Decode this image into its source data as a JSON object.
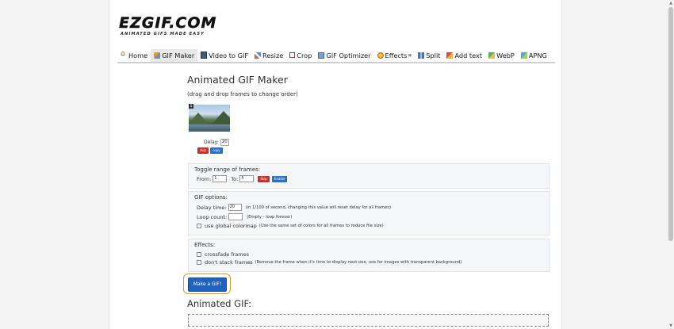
{
  "logo": {
    "main": "EZGIF.COM",
    "tagline": "ANIMATED GIFS MADE EASY"
  },
  "nav": [
    {
      "label": "Home",
      "icon": "home-icon"
    },
    {
      "label": "GIF Maker",
      "icon": "brush-icon",
      "active": true
    },
    {
      "label": "Video to GIF",
      "icon": "film-icon"
    },
    {
      "label": "Resize",
      "icon": "resize-icon"
    },
    {
      "label": "Crop",
      "icon": "crop-icon"
    },
    {
      "label": "GIF Optimizer",
      "icon": "optimizer-icon"
    },
    {
      "label": "Effects",
      "icon": "effects-icon",
      "suffix": "»"
    },
    {
      "label": "Split",
      "icon": "split-icon"
    },
    {
      "label": "Add text",
      "icon": "text-icon"
    },
    {
      "label": "WebP",
      "icon": "webp-icon"
    },
    {
      "label": "APNG",
      "icon": "apng-icon"
    }
  ],
  "main": {
    "title": "Animated GIF Maker",
    "subtitle": "(drag and drop frames to change order)"
  },
  "frame": {
    "number": "1",
    "delay_label": "Delay:",
    "delay_value": "20",
    "skip_label": "skip",
    "copy_label": "copy"
  },
  "toggle": {
    "title": "Toggle range of frames:",
    "from_label": "From:",
    "from_value": "1",
    "to_label": "To:",
    "to_value": "5",
    "skip_label": "Skip",
    "enable_label": "Enable"
  },
  "gif_options": {
    "title": "GIF options:",
    "delay_label": "Delay time:",
    "delay_value": "20",
    "delay_hint": "(in 1/100 of second, changing this value will reset delay for all frames)",
    "loop_label": "Loop count:",
    "loop_value": "",
    "loop_hint": "(Empty - loop forever)",
    "colormap_label": "use global colormap",
    "colormap_hint": "(Use the same set of colors for all frames to reduce file size)"
  },
  "effects": {
    "title": "Effects:",
    "crossfade_label": "crossfade frames",
    "nostack_label": "don't stack frames",
    "nostack_hint": "(Remove the frame when it's time to display next one, use for images with transparent background)"
  },
  "make_button": "Make a GIF!",
  "output_title": "Animated GIF:",
  "colors": {
    "primary": "#1e63bf",
    "danger": "#c9302c",
    "highlight": "#e2962e"
  }
}
